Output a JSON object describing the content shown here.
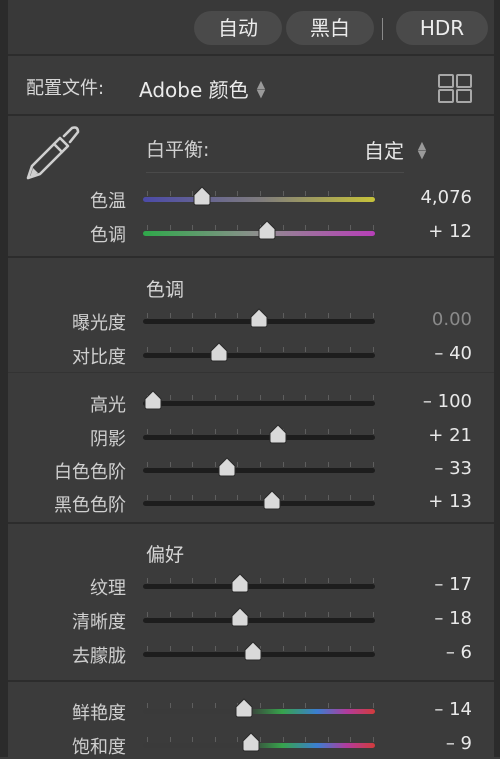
{
  "topbar": {
    "auto_label": "自动",
    "bw_label": "黑白",
    "hdr_label": "HDR"
  },
  "profile": {
    "label": "配置文件:",
    "value": "Adobe 颜色"
  },
  "white_balance": {
    "label": "白平衡:",
    "value": "自定"
  },
  "sliders": {
    "temp": {
      "label": "色温",
      "value": "4,076",
      "position": 0.23
    },
    "tint": {
      "label": "色调",
      "value": "+ 12",
      "position": 0.54
    },
    "exposure": {
      "label": "曝光度",
      "value": "0.00",
      "position": 0.5
    },
    "contrast": {
      "label": "对比度",
      "value": "– 40",
      "position": 0.31
    },
    "highlights": {
      "label": "高光",
      "value": "– 100",
      "position": 0.0
    },
    "shadows": {
      "label": "阴影",
      "value": "+ 21",
      "position": 0.59
    },
    "whites": {
      "label": "白色色阶",
      "value": "– 33",
      "position": 0.35
    },
    "blacks": {
      "label": "黑色色阶",
      "value": "+ 13",
      "position": 0.56
    },
    "texture": {
      "label": "纹理",
      "value": "– 17",
      "position": 0.41
    },
    "clarity": {
      "label": "清晰度",
      "value": "– 18",
      "position": 0.41
    },
    "dehaze": {
      "label": "去朦胧",
      "value": "– 6",
      "position": 0.47
    },
    "vibrance": {
      "label": "鲜艳度",
      "value": "– 14",
      "position": 0.43
    },
    "saturation": {
      "label": "饱和度",
      "value": "– 9",
      "position": 0.46
    }
  },
  "sections": {
    "tone": "色调",
    "presence": "偏好"
  },
  "icons": {
    "eyedropper": "eyedropper-icon",
    "profile_browser": "grid-icon",
    "updown": "updown-arrows-icon"
  },
  "colors": {
    "panel_bg": "#3b3b3b",
    "pill_bg": "#4a4a4a",
    "thumb": "#d9d9d9"
  }
}
